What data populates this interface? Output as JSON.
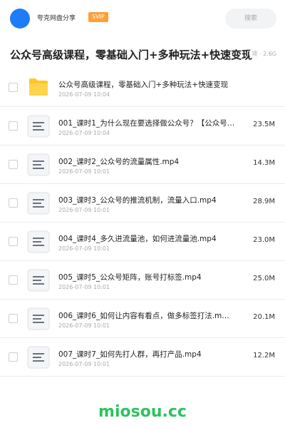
{
  "header": {
    "share_name": "夸克网盘分享",
    "badge": "SVIP",
    "search_placeholder": "搜索"
  },
  "folder": {
    "title": "公众号高级课程，零基础入门+多种玩法+快速变现",
    "meta": "项 · 2.6G"
  },
  "files": [
    {
      "type": "folder",
      "name": "公众号高级课程，零基础入门+多种玩法+快速变现",
      "date": "2026-07-09 10:04",
      "size": ""
    },
    {
      "type": "doc",
      "name": "001_课时1_为什么现在要选择做公众号？【公众号…",
      "date": "2026-07-09 10:04",
      "size": "23.5M"
    },
    {
      "type": "doc",
      "name": "002_课时2_公众号的流量属性.mp4",
      "date": "2026-07-09 10:01",
      "size": "14.3M"
    },
    {
      "type": "doc",
      "name": "003_课时3_公众号的推流机制，流量入口.mp4",
      "date": "2026-07-09 10:01",
      "size": "28.9M"
    },
    {
      "type": "doc",
      "name": "004_课时4_多久进流量池，如何进流量池.mp4",
      "date": "2026-07-09 10:01",
      "size": "23.0M"
    },
    {
      "type": "doc",
      "name": "005_课时5_公众号矩阵，账号打标签.mp4",
      "date": "2026-07-09 10:01",
      "size": "25.0M"
    },
    {
      "type": "doc",
      "name": "006_课时6_如何让内容有看点，做多标签打法.m…",
      "date": "2026-07-09 10:01",
      "size": "20.1M"
    },
    {
      "type": "doc",
      "name": "007_课时7_如何先打人群，再打产品.mp4",
      "date": "2026-07-09 10:01",
      "size": "12.2M"
    }
  ],
  "watermark": "miosou.cc",
  "colors": {
    "accent_blue": "#1e7cf6",
    "svip_orange": "#ffa033",
    "folder_yellow": "#ffc629",
    "watermark_green": "#2ec25f"
  }
}
